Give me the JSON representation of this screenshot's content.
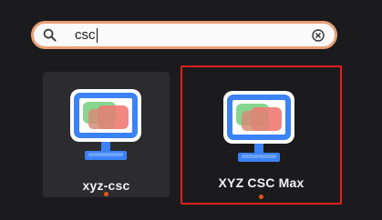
{
  "search": {
    "query": "csc",
    "icon": "search-icon",
    "clear_icon": "clear-icon"
  },
  "results": [
    {
      "label": "xyz-csc",
      "icon": "monitor-app-icon",
      "running": true,
      "selected": false
    },
    {
      "label": "XYZ CSC Max",
      "icon": "monitor-app-icon",
      "running": true,
      "selected": true
    }
  ],
  "colors": {
    "background": "#1b1b1d",
    "search_border": "#e8a078",
    "selection_border": "#e02020",
    "running_dot": "#e9541b",
    "monitor_blue": "#3b82f6"
  }
}
